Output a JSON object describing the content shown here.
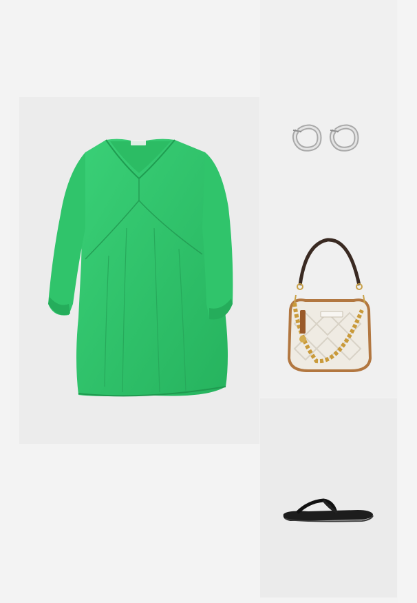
{
  "outfit": {
    "items": [
      {
        "id": "dress",
        "icon": "green-tunic-dress-image",
        "color": "#2fc36a"
      },
      {
        "id": "earrings",
        "icon": "silver-hoop-earrings-image",
        "color": "#c9c9c9"
      },
      {
        "id": "handbag",
        "icon": "monogram-shoulder-bag-image",
        "color": "#ece8e0"
      },
      {
        "id": "sandals",
        "icon": "black-thong-sandal-image",
        "color": "#1c1c1c"
      }
    ]
  }
}
